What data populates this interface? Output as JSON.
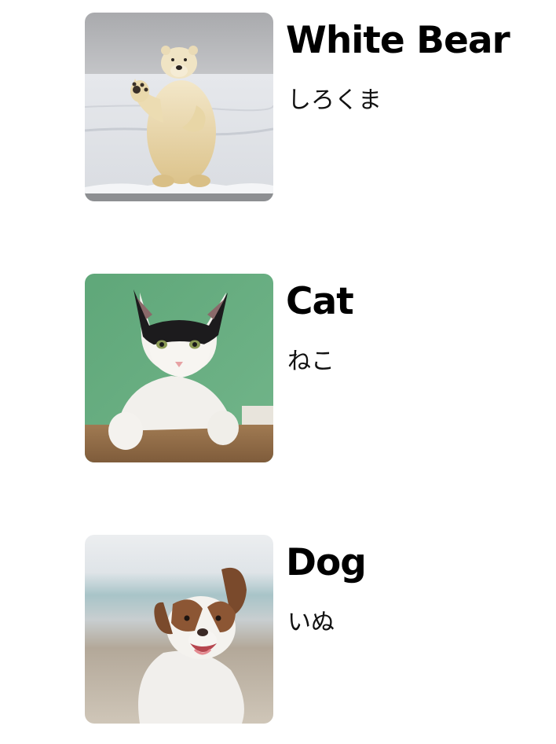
{
  "animals": [
    {
      "title": "White Bear",
      "subtitle": "しろくま",
      "image": "polar-bear-photo"
    },
    {
      "title": "Cat",
      "subtitle": "ねこ",
      "image": "cat-photo"
    },
    {
      "title": "Dog",
      "subtitle": "いぬ",
      "image": "dog-photo"
    }
  ]
}
